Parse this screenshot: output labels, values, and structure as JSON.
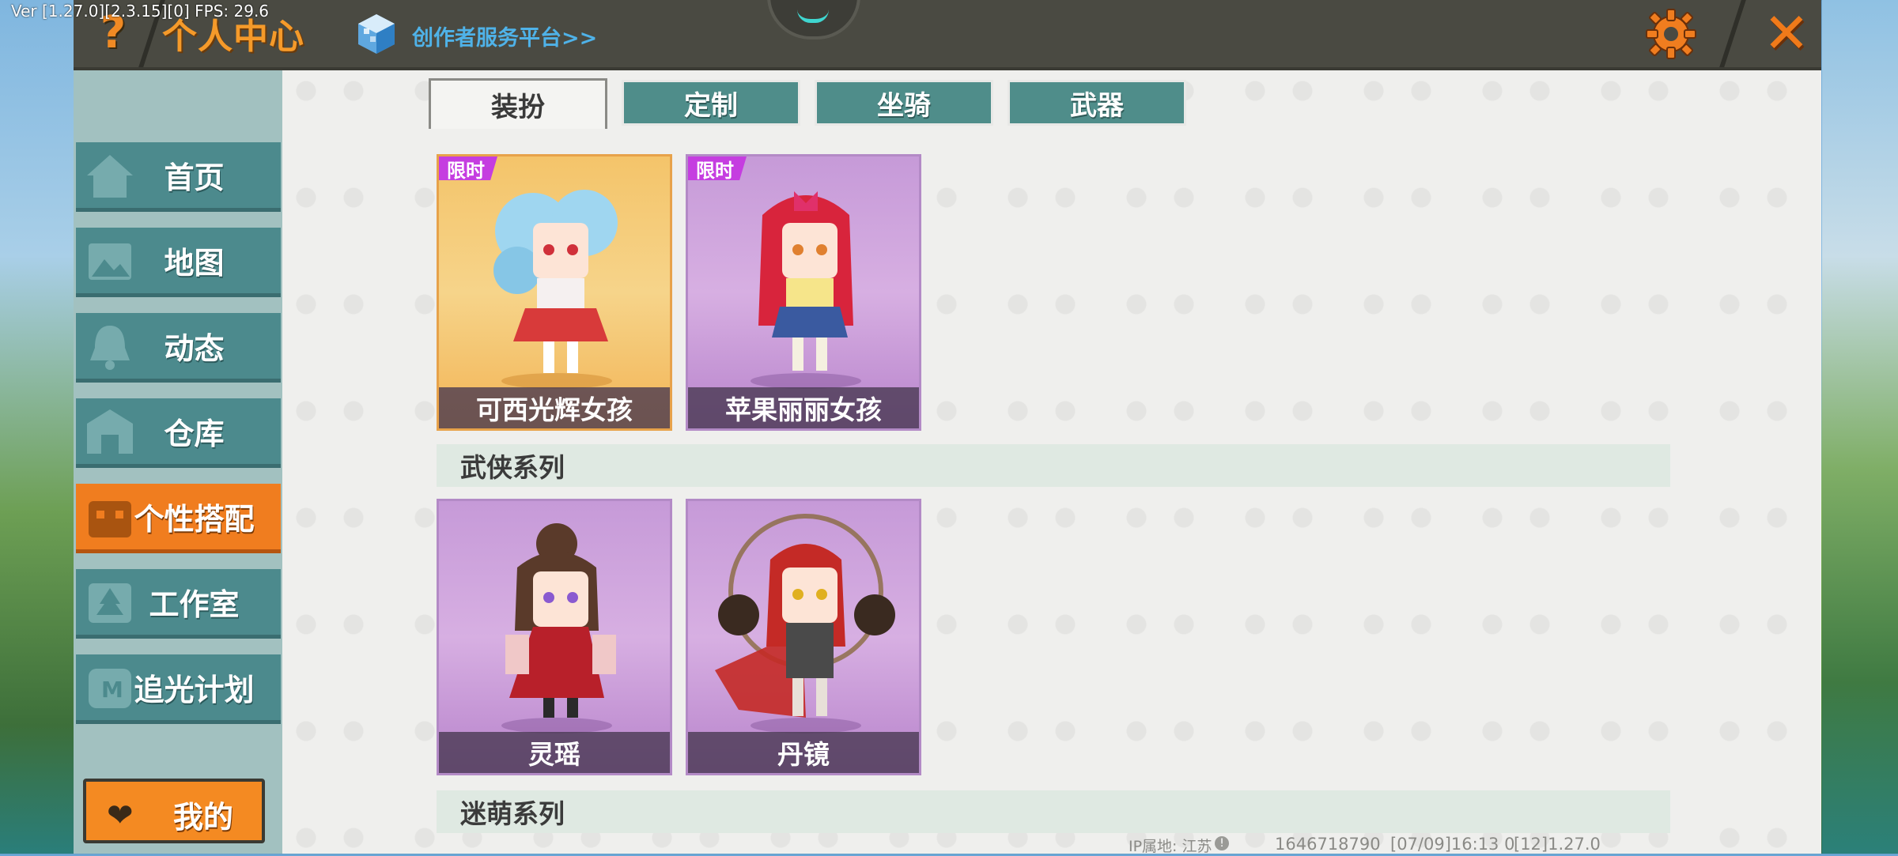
{
  "version_text": "Ver [1.27.0][2.3.15][0] FPS: 29.6",
  "header": {
    "help_icon": "question-mark-icon",
    "title": "个人中心",
    "creator_link": "创作者服务平台>>",
    "settings_icon": "gear-icon",
    "close_icon": "close-x-icon",
    "accent_color": "#f59a2a"
  },
  "sidebar": {
    "items": [
      {
        "label": "首页",
        "icon": "home-icon"
      },
      {
        "label": "地图",
        "icon": "map-icon"
      },
      {
        "label": "动态",
        "icon": "bell-icon"
      },
      {
        "label": "仓库",
        "icon": "warehouse-icon"
      },
      {
        "label": "个性搭配",
        "icon": "outfit-icon",
        "active": true
      },
      {
        "label": "工作室",
        "icon": "studio-icon"
      },
      {
        "label": "追光计划",
        "icon": "spotlight-icon"
      }
    ],
    "mine_button": {
      "label": "我的",
      "icon": "heart-icon"
    }
  },
  "tabs": [
    {
      "label": "装扮",
      "active": true
    },
    {
      "label": "定制"
    },
    {
      "label": "坐骑"
    },
    {
      "label": "武器"
    }
  ],
  "cards_row1": [
    {
      "name": "可西光辉女孩",
      "badge": "限时",
      "theme": "gold"
    },
    {
      "name": "苹果丽丽女孩",
      "badge": "限时",
      "theme": "purple"
    }
  ],
  "section1": {
    "title": "武侠系列"
  },
  "cards_row2": [
    {
      "name": "灵瑶",
      "theme": "purple"
    },
    {
      "name": "丹镜",
      "theme": "purple"
    }
  ],
  "section2": {
    "title": "迷萌系列"
  },
  "footer": {
    "ip_location": "IP属地: 江苏",
    "user_id": "1646718790",
    "time": "[07/09]16:13 0",
    "build": "[12]1.27.0"
  }
}
